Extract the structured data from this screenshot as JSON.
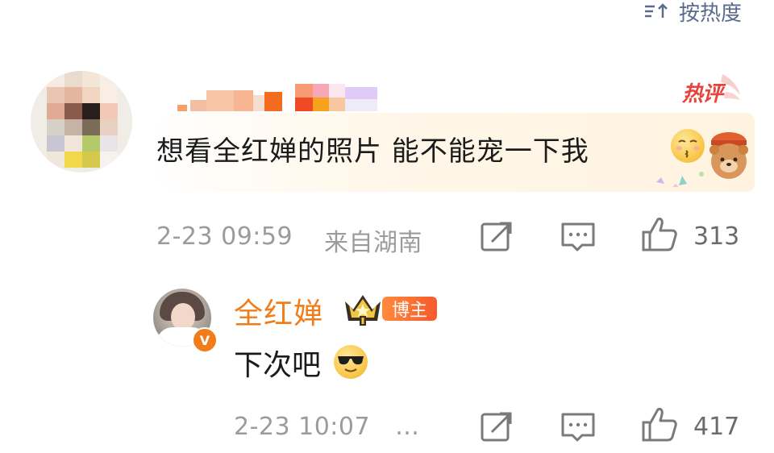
{
  "sort": {
    "label": "按热度",
    "icon": "sort-icon"
  },
  "comment": {
    "badge": "热评",
    "text": "想看全红婵的照片 能不能宠一下我",
    "time": "2-23 09:59",
    "location": "来自湖南",
    "likes": "313",
    "icons": [
      "share-icon",
      "comment-icon",
      "like-icon"
    ]
  },
  "reply": {
    "username": "全红婵",
    "tag": "博主",
    "text": "下次吧",
    "time": "2-23 10:07",
    "ellipsis": "…",
    "likes": "417",
    "verified_badge": "V"
  },
  "colors": {
    "accent_orange": "#f07d1a",
    "hot_red": "#e8423c",
    "meta_grey": "#9b9b9b",
    "link_blue": "#5b6b8c"
  }
}
